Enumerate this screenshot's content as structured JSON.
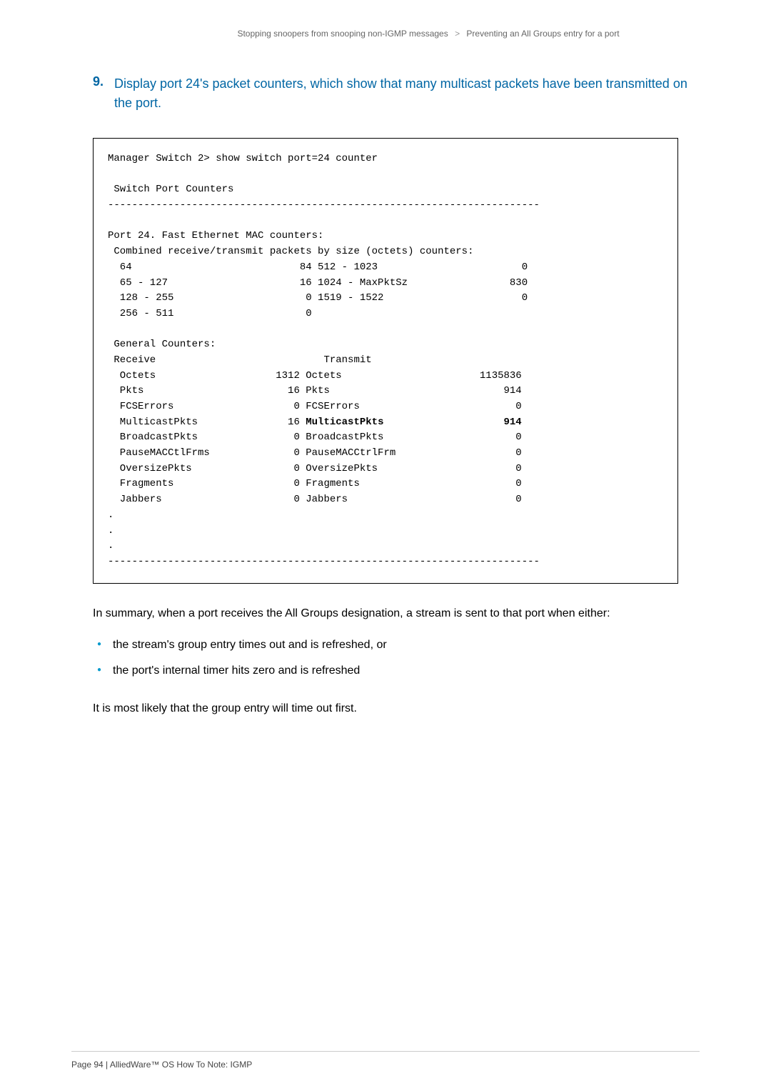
{
  "breadcrumb": {
    "left": "Stopping snoopers from snooping non-IGMP messages",
    "right": "Preventing an All Groups entry for a port"
  },
  "step": {
    "num": "9.",
    "text": "Display port 24's packet counters, which show that many multicast packets have been transmitted on the port."
  },
  "terminal": {
    "command": "Manager Switch 2> show switch port=24 counter",
    "title": " Switch Port Counters",
    "divider": "------------------------------------------------------------------------",
    "port_header": "Port 24. Fast Ethernet MAC counters:",
    "combined_header": " Combined receive/transmit packets by size (octets) counters:",
    "size_counters": [
      {
        "left_label": "64",
        "left_val": "84",
        "right_label": "512 - 1023",
        "right_val": "0"
      },
      {
        "left_label": "65 - 127",
        "left_val": "16",
        "right_label": "1024 - MaxPktSz",
        "right_val": "830"
      },
      {
        "left_label": "128 - 255",
        "left_val": "0",
        "right_label": "1519 - 1522",
        "right_val": "0"
      },
      {
        "left_label": "256 - 511",
        "left_val": "0",
        "right_label": "",
        "right_val": ""
      }
    ],
    "general_header": " General Counters:",
    "col_receive": " Receive",
    "col_transmit": "Transmit",
    "counters": [
      {
        "rx_label": "Octets",
        "rx_val": "1312",
        "tx_label": "Octets",
        "tx_val": "1135836",
        "bold": false
      },
      {
        "rx_label": "Pkts",
        "rx_val": "16",
        "tx_label": "Pkts",
        "tx_val": "914",
        "bold": false
      },
      {
        "rx_label": "FCSErrors",
        "rx_val": "0",
        "tx_label": "FCSErrors",
        "tx_val": "0",
        "bold": false
      },
      {
        "rx_label": "MulticastPkts",
        "rx_val": "16",
        "tx_label": "MulticastPkts",
        "tx_val": "914",
        "bold": true
      },
      {
        "rx_label": "BroadcastPkts",
        "rx_val": "0",
        "tx_label": "BroadcastPkts",
        "tx_val": "0",
        "bold": false
      },
      {
        "rx_label": "PauseMACCtlFrms",
        "rx_val": "0",
        "tx_label": "PauseMACCtrlFrm",
        "tx_val": "0",
        "bold": false
      },
      {
        "rx_label": "OversizePkts",
        "rx_val": "0",
        "tx_label": "OversizePkts",
        "tx_val": "0",
        "bold": false
      },
      {
        "rx_label": "Fragments",
        "rx_val": "0",
        "tx_label": "Fragments",
        "tx_val": "0",
        "bold": false
      },
      {
        "rx_label": "Jabbers",
        "rx_val": "0",
        "tx_label": "Jabbers",
        "tx_val": "0",
        "bold": false
      }
    ],
    "dots": ".\n.\n."
  },
  "summary_text": "In summary, when a port receives the All Groups designation, a stream is sent to that port when either:",
  "bullets": {
    "b1": "the stream's group entry times out and is refreshed, or",
    "b2": "the port's internal timer hits zero and is refreshed"
  },
  "closing_text": "It is most likely that the group entry will time out first.",
  "footer": "Page 94 | AlliedWare™ OS How To Note: IGMP"
}
